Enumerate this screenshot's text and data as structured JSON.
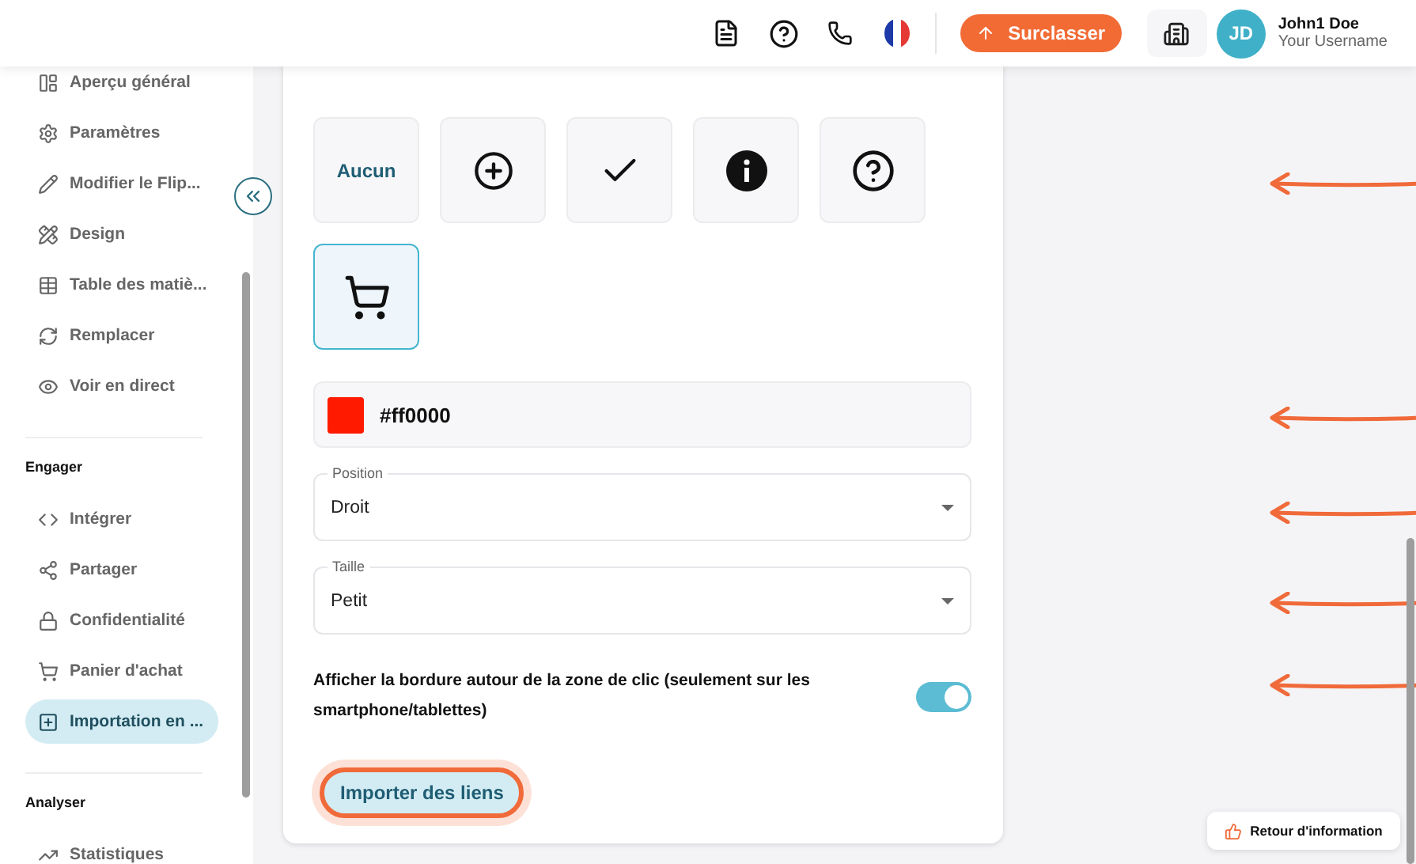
{
  "header": {
    "upgrade_button": "Surclasser",
    "user": {
      "initials": "JD",
      "name": "John1 Doe",
      "username": "Your Username"
    }
  },
  "sidebar": {
    "sections": [
      {
        "items": [
          {
            "label": "Aperçu général",
            "selected": false
          },
          {
            "label": "Paramètres",
            "selected": false
          },
          {
            "label": "Modifier le Flip...",
            "selected": false
          },
          {
            "label": "Design",
            "selected": false
          },
          {
            "label": "Table des matiè...",
            "selected": false
          },
          {
            "label": "Remplacer",
            "selected": false
          },
          {
            "label": "Voir en direct",
            "selected": false
          }
        ]
      },
      {
        "title": "Engager",
        "items": [
          {
            "label": "Intégrer",
            "selected": false
          },
          {
            "label": "Partager",
            "selected": false
          },
          {
            "label": "Confidentialité",
            "selected": false
          },
          {
            "label": "Panier d'achat",
            "selected": false
          },
          {
            "label": "Importation en ...",
            "selected": true
          }
        ]
      },
      {
        "title": "Analyser",
        "items": [
          {
            "label": "Statistiques",
            "selected": false
          }
        ]
      }
    ]
  },
  "icon_options": [
    {
      "kind": "text",
      "label": "Aucun",
      "selected": false
    },
    {
      "kind": "plus",
      "selected": false
    },
    {
      "kind": "check",
      "selected": false
    },
    {
      "kind": "info",
      "selected": false
    },
    {
      "kind": "help",
      "selected": false
    },
    {
      "kind": "cart",
      "selected": true
    }
  ],
  "color_field": {
    "value": "#ff0000",
    "color": "#ff1a00"
  },
  "selects": [
    {
      "label": "Position",
      "value": "Droit"
    },
    {
      "label": "Taille",
      "value": "Petit"
    }
  ],
  "toggle": {
    "label": "Afficher la bordure autour de la zone de clic (seulement sur les smartphone/tablettes)",
    "on": true
  },
  "import_button": {
    "label": "Importer des liens",
    "highlighted": true
  },
  "feedback_button": "Retour d'information"
}
